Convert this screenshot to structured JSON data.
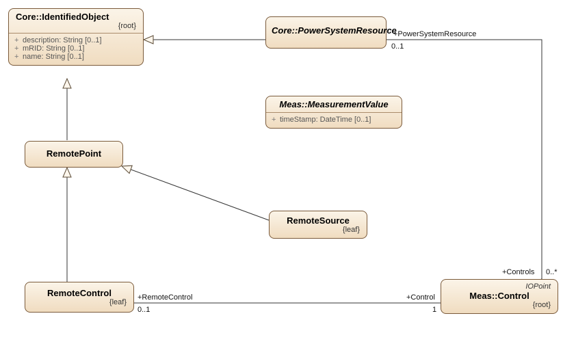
{
  "classes": {
    "identifiedObject": {
      "title": "Core::IdentifiedObject",
      "constraint": "{root}",
      "attrs": [
        {
          "vis": "+",
          "text": "description: String [0..1]"
        },
        {
          "vis": "+",
          "text": "mRID: String [0..1]"
        },
        {
          "vis": "+",
          "text": "name: String [0..1]"
        }
      ]
    },
    "powerSystemResource": {
      "title": "Core::PowerSystemResource"
    },
    "measurementValue": {
      "title": "Meas::MeasurementValue",
      "attrs": [
        {
          "vis": "+",
          "text": "timeStamp: DateTime [0..1]"
        }
      ]
    },
    "remotePoint": {
      "title": "RemotePoint"
    },
    "remoteSource": {
      "title": "RemoteSource",
      "constraint": "{leaf}"
    },
    "remoteControl": {
      "title": "RemoteControl",
      "constraint": "{leaf}"
    },
    "control": {
      "title": "Meas::Control",
      "stereo": "IOPoint",
      "constraint": "{root}"
    }
  },
  "assoc": {
    "psr": {
      "role": "+PowerSystemResource",
      "mult": "0..1"
    },
    "controls": {
      "role": "+Controls",
      "mult": "0..*"
    },
    "remoteControl": {
      "roleA": "+RemoteControl",
      "multA": "0..1",
      "roleB": "+Control",
      "multB": "1"
    }
  },
  "chart_data": {
    "type": "uml-class-diagram",
    "classes": [
      {
        "id": "IdentifiedObject",
        "qualified": "Core::IdentifiedObject",
        "constraint": "root",
        "abstract": false,
        "attributes": [
          "description: String [0..1]",
          "mRID: String [0..1]",
          "name: String [0..1]"
        ]
      },
      {
        "id": "PowerSystemResource",
        "qualified": "Core::PowerSystemResource",
        "abstract": true
      },
      {
        "id": "MeasurementValue",
        "qualified": "Meas::MeasurementValue",
        "abstract": true,
        "attributes": [
          "timeStamp: DateTime [0..1]"
        ]
      },
      {
        "id": "RemotePoint",
        "qualified": "RemotePoint"
      },
      {
        "id": "RemoteSource",
        "qualified": "RemoteSource",
        "constraint": "leaf"
      },
      {
        "id": "RemoteControl",
        "qualified": "RemoteControl",
        "constraint": "leaf"
      },
      {
        "id": "Control",
        "qualified": "Meas::Control",
        "constraint": "root",
        "stereotype": "IOPoint"
      }
    ],
    "generalizations": [
      {
        "child": "PowerSystemResource",
        "parent": "IdentifiedObject"
      },
      {
        "child": "RemotePoint",
        "parent": "IdentifiedObject"
      },
      {
        "child": "RemoteSource",
        "parent": "RemotePoint"
      },
      {
        "child": "RemoteControl",
        "parent": "RemotePoint"
      }
    ],
    "associations": [
      {
        "endA": {
          "class": "PowerSystemResource",
          "role": "+PowerSystemResource",
          "mult": "0..1"
        },
        "endB": {
          "class": "Control",
          "role": "+Controls",
          "mult": "0..*"
        }
      },
      {
        "endA": {
          "class": "RemoteControl",
          "role": "+RemoteControl",
          "mult": "0..1"
        },
        "endB": {
          "class": "Control",
          "role": "+Control",
          "mult": "1"
        }
      }
    ]
  }
}
